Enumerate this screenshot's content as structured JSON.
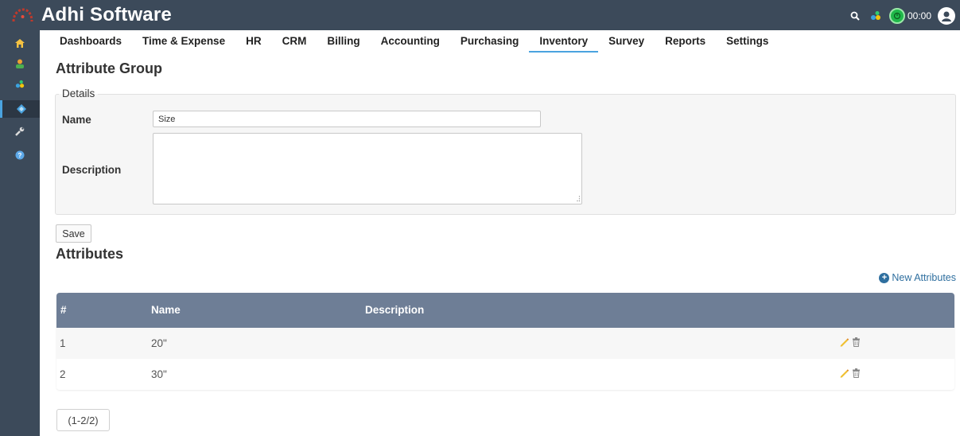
{
  "app": {
    "title": "Adhi Software"
  },
  "topbar": {
    "timer": "00:00",
    "icons": [
      "search-icon",
      "modules-icon",
      "timer-icon",
      "user-avatar-icon"
    ]
  },
  "sidebar": {
    "items": [
      "home-icon",
      "contacts-icon",
      "modules-icon",
      "inventory-icon",
      "settings-wrench-icon",
      "help-icon"
    ],
    "active_index": 3
  },
  "nav": {
    "items": [
      "Dashboards",
      "Time & Expense",
      "HR",
      "CRM",
      "Billing",
      "Accounting",
      "Purchasing",
      "Inventory",
      "Survey",
      "Reports",
      "Settings"
    ],
    "active": "Inventory"
  },
  "page": {
    "title": "Attribute Group"
  },
  "details": {
    "legend": "Details",
    "name_label": "Name",
    "name_value": "Size",
    "description_label": "Description",
    "description_value": ""
  },
  "save_label": "Save",
  "attributes": {
    "title": "Attributes",
    "new_label": "New Attributes",
    "columns": [
      "#",
      "Name",
      "Description"
    ],
    "rows": [
      {
        "num": "1",
        "name": "20\"",
        "description": ""
      },
      {
        "num": "2",
        "name": "30\"",
        "description": ""
      }
    ]
  },
  "pager": {
    "label": "(1-2/2)"
  },
  "colors": {
    "topbar": "#3c4a5a",
    "table_header": "#6e7e96",
    "accent": "#4aa3df",
    "link": "#2f6f9f"
  }
}
